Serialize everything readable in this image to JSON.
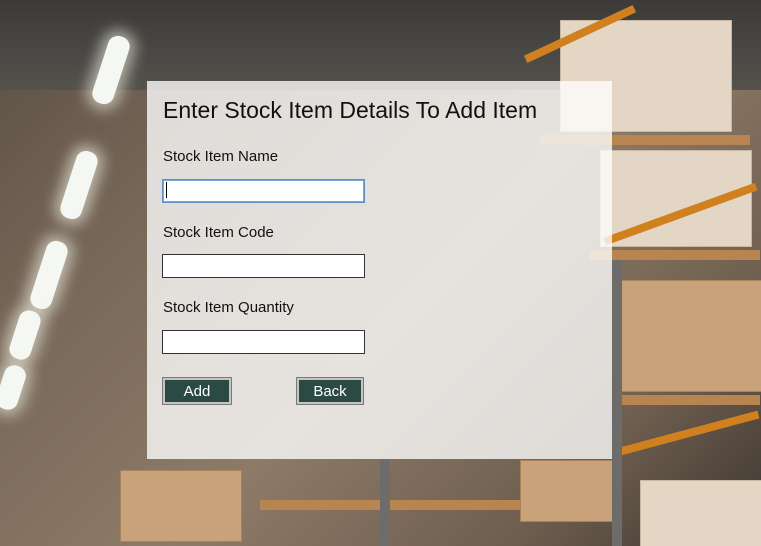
{
  "form": {
    "title": "Enter Stock Item Details To Add Item",
    "fields": [
      {
        "label": "Stock Item Name",
        "value": ""
      },
      {
        "label": "Stock Item Code",
        "value": ""
      },
      {
        "label": "Stock Item Quantity",
        "value": ""
      }
    ],
    "buttons": {
      "add_label": "Add",
      "back_label": "Back"
    }
  },
  "colors": {
    "button_bg": "#2c4a44",
    "panel_bg": "rgba(255,255,255,0.78)"
  }
}
